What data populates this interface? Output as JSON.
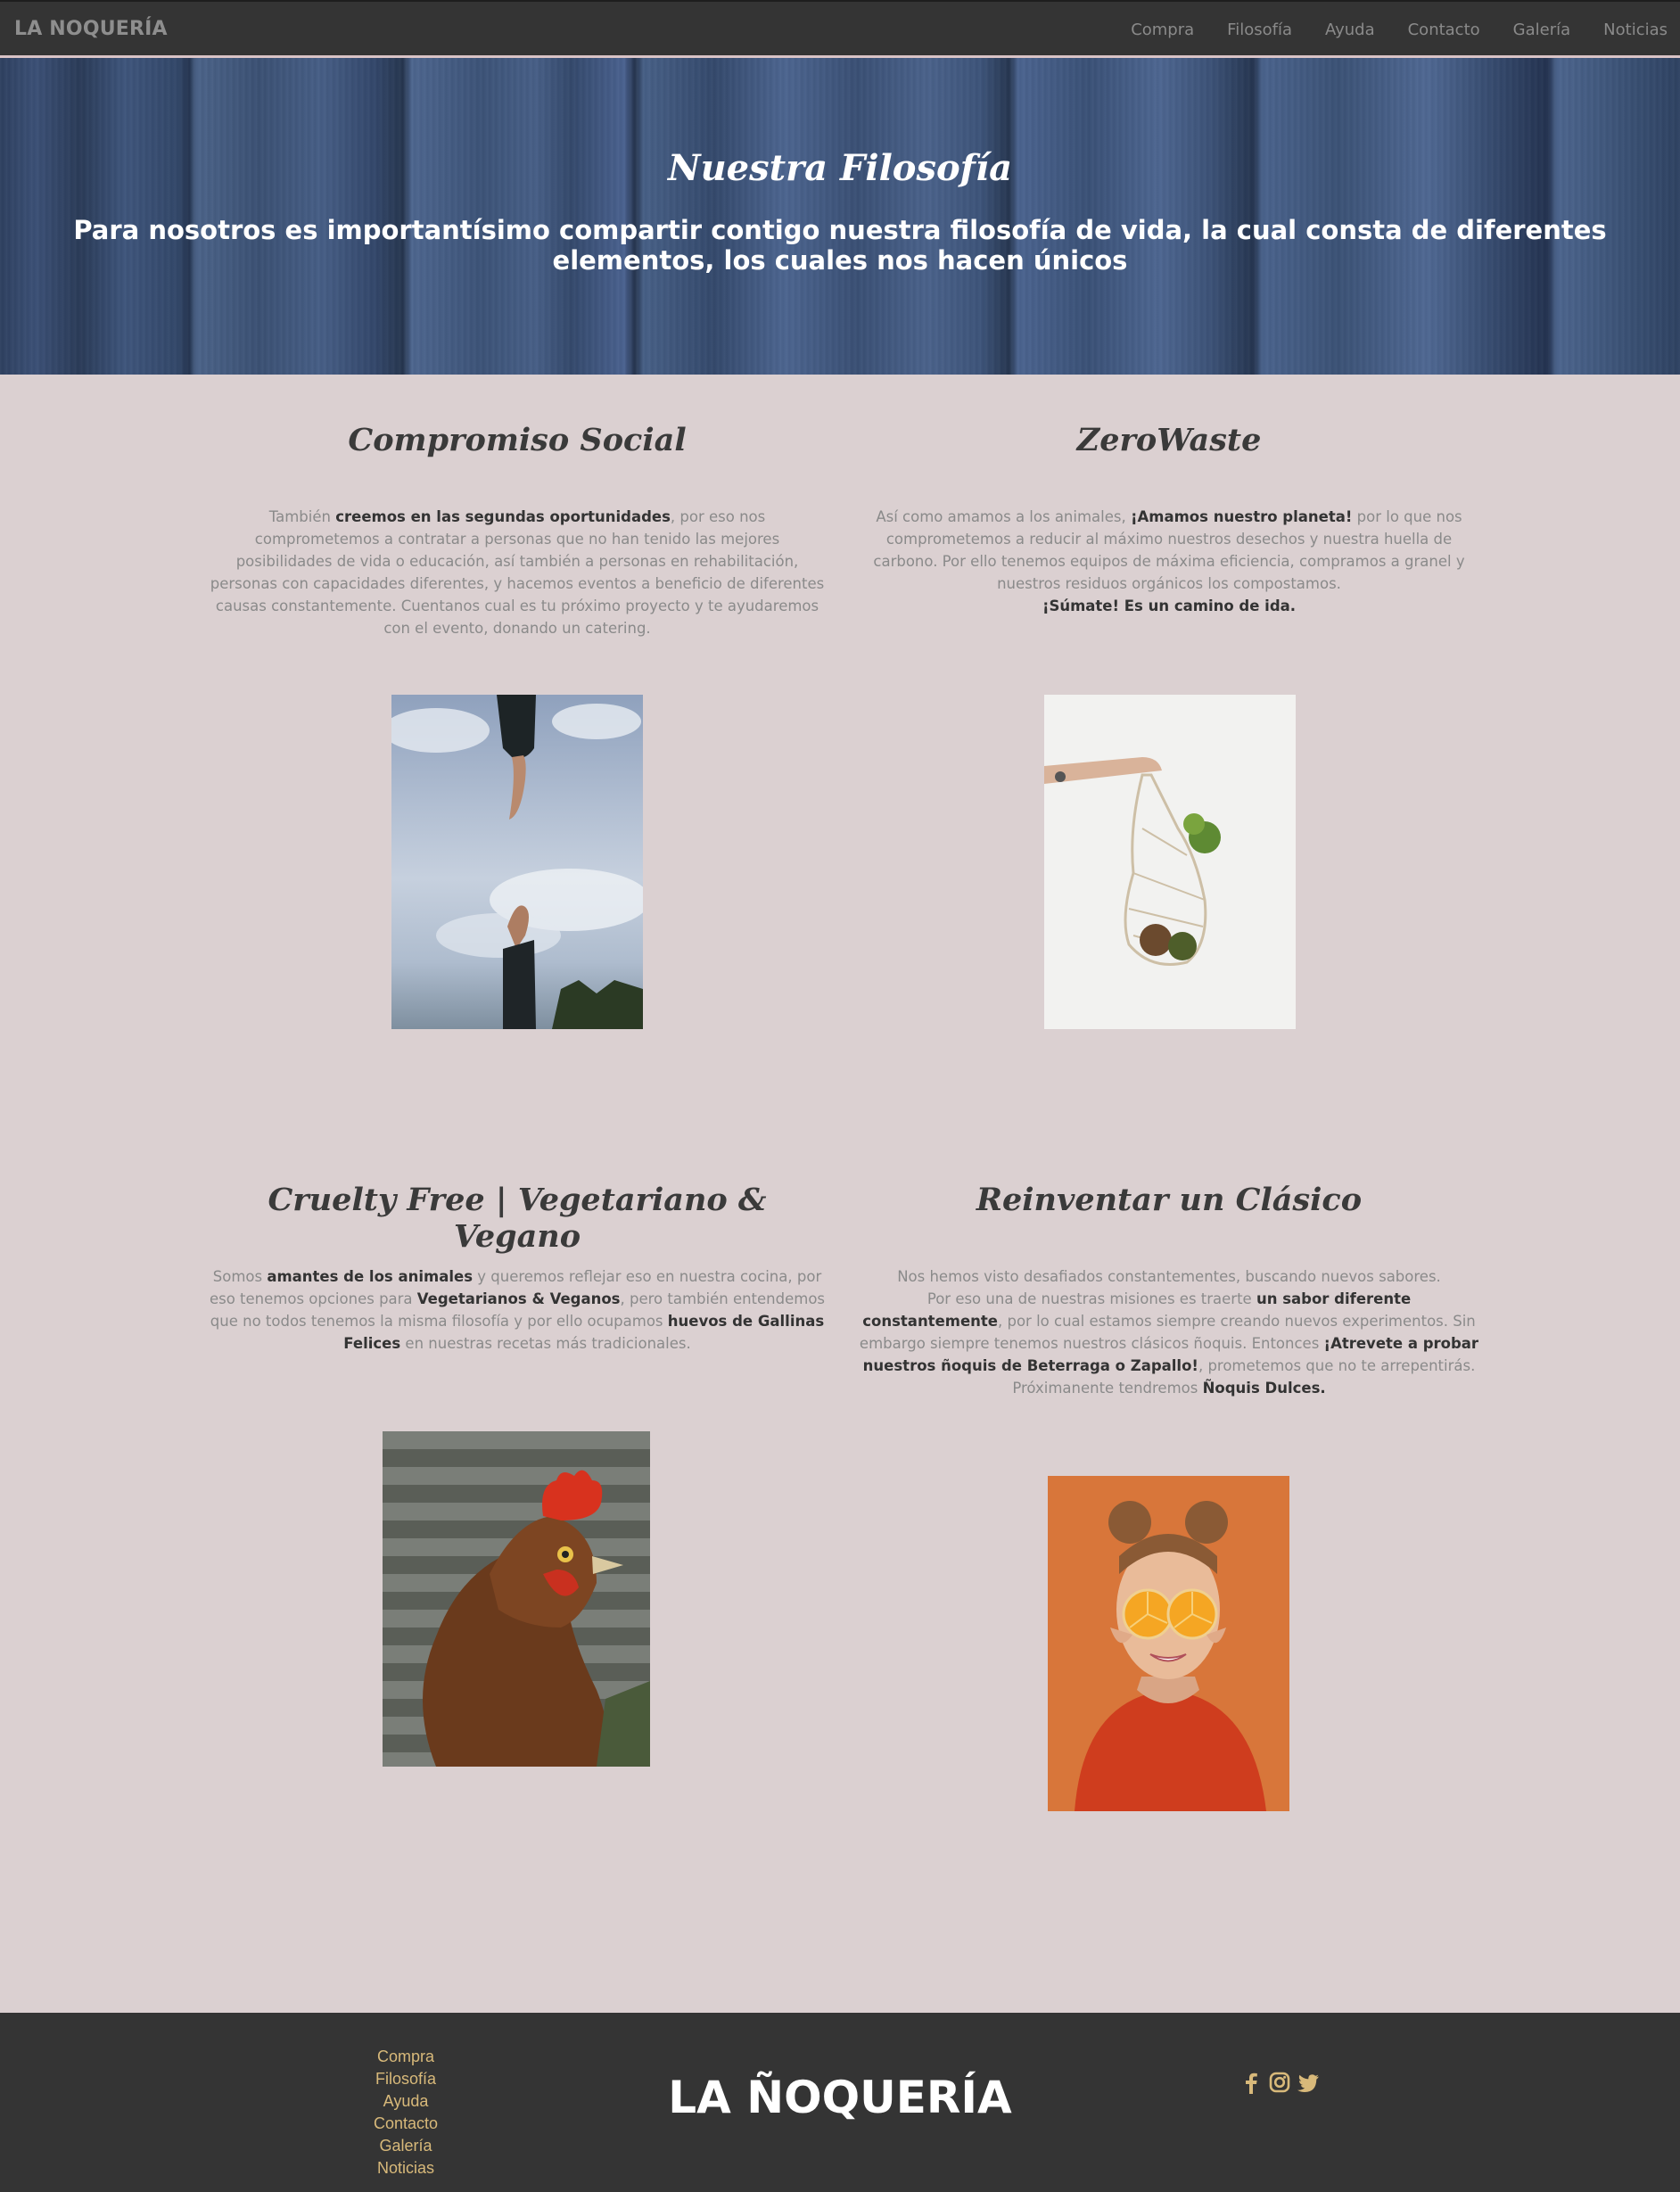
{
  "navbar": {
    "brand": "LA NOQUERÍA",
    "links": [
      "Compra",
      "Filosofía",
      "Ayuda",
      "Contacto",
      "Galería",
      "Noticias"
    ]
  },
  "hero": {
    "title": "Nuestra Filosofía",
    "subtitle": "Para nosotros es importantísimo compartir contigo nuestra filosofía de vida, la cual consta de diferentes elementos, los cuales nos hacen únicos"
  },
  "sections": [
    {
      "title": "Compromiso Social",
      "text": [
        {
          "t": "También ",
          "b": false
        },
        {
          "t": "creemos en las segundas oportunidades",
          "b": true
        },
        {
          "t": ", por eso nos comprometemos a contratar a personas que no han tenido las mejores posibilidades de vida o educación, así también a personas en rehabilitación, personas con capacidades diferentes, y hacemos eventos a beneficio de diferentes causas constantemente. Cuentanos cual es tu próximo proyecto y te ayudaremos con el evento, donando un catering.",
          "b": false
        }
      ]
    },
    {
      "title": "ZeroWaste",
      "text": [
        {
          "t": "Así como amamos a los animales, ",
          "b": false
        },
        {
          "t": "¡Amamos nuestro planeta!",
          "b": true
        },
        {
          "t": " por lo que nos comprometemos a reducir al máximo nuestros desechos y nuestra huella de carbono. Por ello tenemos equipos de máxima eficiencia, compramos a granel y nuestros residuos orgánicos los compostamos.",
          "b": false
        },
        {
          "t": "¡Súmate! Es un camino de ida.",
          "b": true,
          "br": true
        }
      ]
    },
    {
      "title": "Cruelty Free | Vegetariano & Vegano",
      "text": [
        {
          "t": "Somos ",
          "b": false
        },
        {
          "t": "amantes de los animales",
          "b": true
        },
        {
          "t": " y queremos reflejar eso en nuestra cocina, por eso tenemos opciones para ",
          "b": false
        },
        {
          "t": "Vegetarianos & Veganos",
          "b": true
        },
        {
          "t": ", pero también entendemos que no todos tenemos la misma filosofía y por ello ocupamos ",
          "b": false
        },
        {
          "t": "huevos de Gallinas Felices",
          "b": true
        },
        {
          "t": " en nuestras recetas más tradicionales.",
          "b": false
        }
      ]
    },
    {
      "title": "Reinventar un Clásico",
      "text": [
        {
          "t": "Nos hemos visto desafiados constantementes, buscando nuevos sabores.",
          "b": false
        },
        {
          "t": "Por eso una de nuestras misiones es traerte ",
          "b": false,
          "br": true
        },
        {
          "t": "un sabor diferente constantemente",
          "b": true
        },
        {
          "t": ", por lo cual estamos siempre creando nuevos experimentos. Sin embargo siempre tenemos nuestros clásicos ñoquis. Entonces ",
          "b": false
        },
        {
          "t": "¡Atrevete a probar nuestros ñoquis de Beterraga o Zapallo!",
          "b": true
        },
        {
          "t": ", prometemos que no te arrepentirás.",
          "b": false
        },
        {
          "t": "Próximanente tendremos ",
          "b": false,
          "br": true
        },
        {
          "t": "Ñoquis Dulces.",
          "b": true
        }
      ]
    }
  ],
  "footer": {
    "links": [
      "Compra",
      "Filosofía",
      "Ayuda",
      "Contacto",
      "Galería",
      "Noticias"
    ],
    "logo": "LA ÑOQUERÍA",
    "social_icons": [
      "facebook-icon",
      "instagram-icon",
      "twitter-icon"
    ],
    "icon_color": "#d8b97a"
  }
}
